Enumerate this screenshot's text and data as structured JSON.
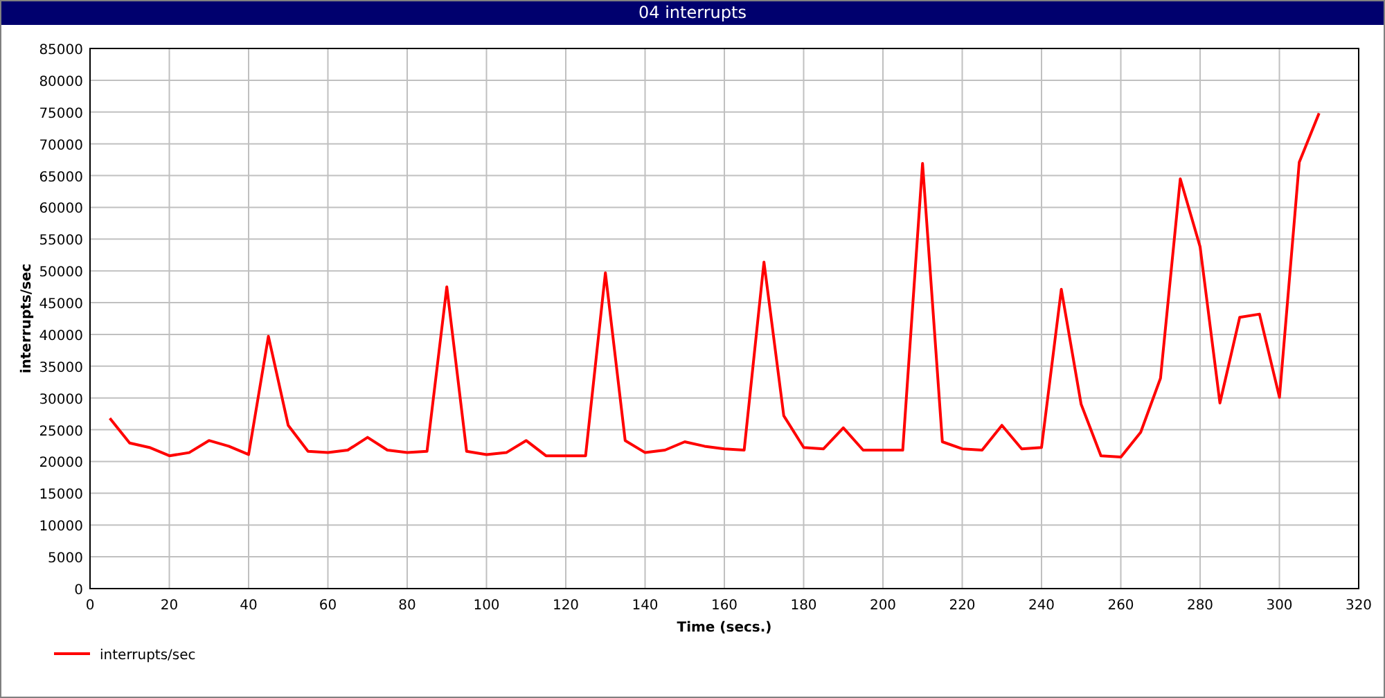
{
  "window": {
    "title": "04 interrupts"
  },
  "chart": {
    "chart_data": {
      "type": "line",
      "xlabel": "Time (secs.)",
      "ylabel": "interrupts/sec",
      "x": [
        5,
        10,
        15,
        20,
        25,
        30,
        35,
        40,
        45,
        50,
        55,
        60,
        65,
        70,
        75,
        80,
        85,
        90,
        95,
        100,
        105,
        110,
        115,
        120,
        125,
        130,
        135,
        140,
        145,
        150,
        155,
        160,
        165,
        170,
        175,
        180,
        185,
        190,
        195,
        200,
        205,
        210,
        215,
        220,
        225,
        230,
        235,
        240,
        245,
        250,
        255,
        260,
        265,
        270,
        275,
        280,
        285,
        290,
        295,
        300,
        305,
        310
      ],
      "series": [
        {
          "name": "interrupts/sec",
          "color": "#ff0000",
          "values": [
            26800,
            22900,
            22200,
            20900,
            21400,
            23300,
            22400,
            21100,
            39700,
            25700,
            21600,
            21400,
            21800,
            23800,
            21800,
            21400,
            21600,
            47500,
            21600,
            21100,
            21400,
            23300,
            20900,
            20900,
            20900,
            49700,
            23300,
            21400,
            21800,
            23100,
            22400,
            22000,
            21800,
            51400,
            27200,
            22200,
            22000,
            25300,
            21800,
            21800,
            21800,
            66900,
            23100,
            22000,
            21800,
            25700,
            22000,
            22200,
            47100,
            29000,
            20900,
            20700,
            24600,
            33100,
            64500,
            53800,
            29200,
            42700,
            43200,
            30100,
            67100,
            74800
          ]
        }
      ],
      "grid": true,
      "xlim": [
        0,
        320
      ],
      "ylim": [
        0,
        85000
      ],
      "xticks": [
        0,
        20,
        40,
        60,
        80,
        100,
        120,
        140,
        160,
        180,
        200,
        220,
        240,
        260,
        280,
        300,
        320
      ],
      "yticks": [
        0,
        5000,
        10000,
        15000,
        20000,
        25000,
        30000,
        35000,
        40000,
        45000,
        50000,
        55000,
        60000,
        65000,
        70000,
        75000,
        80000,
        85000
      ]
    }
  }
}
